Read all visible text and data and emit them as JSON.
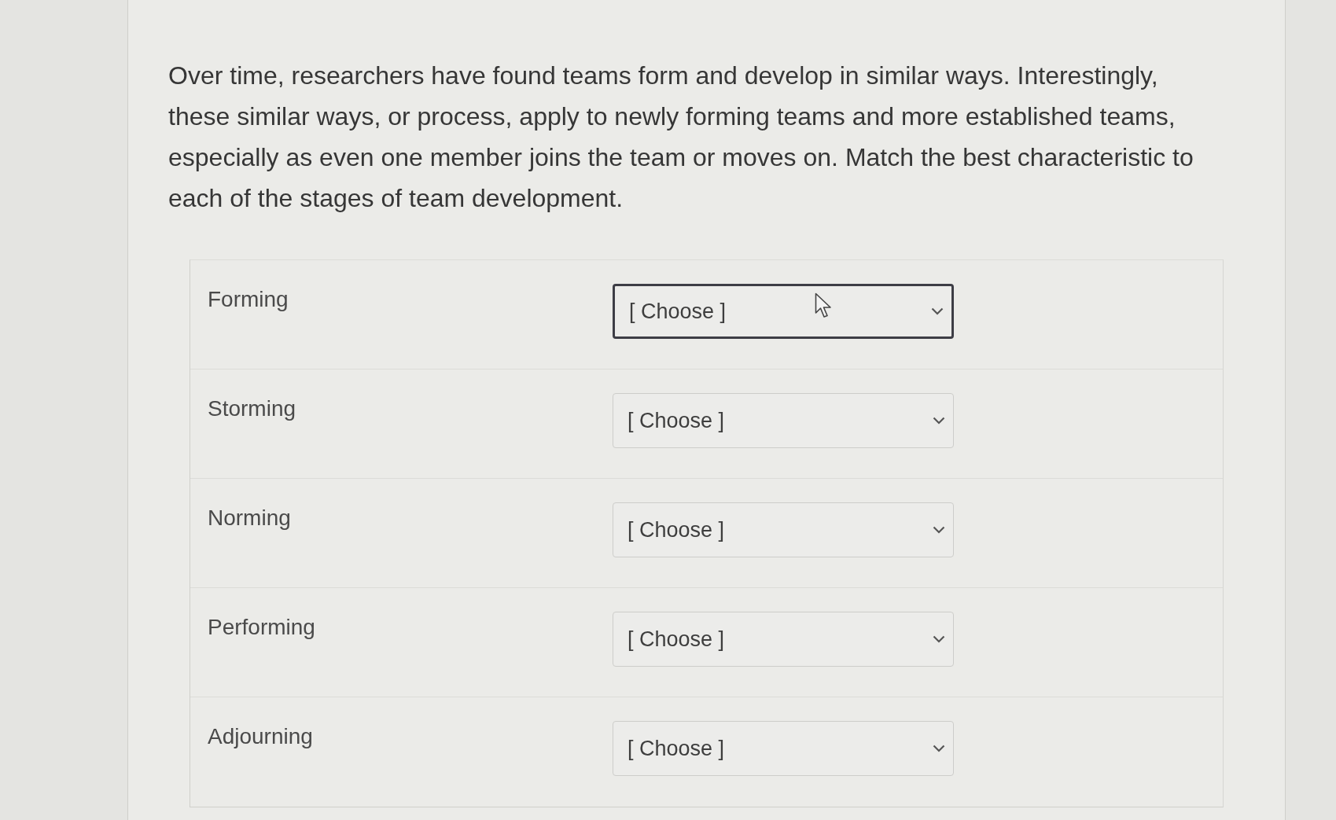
{
  "question": {
    "prompt": "Over time, researchers have found teams form and develop in similar ways. Interestingly, these similar ways, or process, apply to newly forming teams and more established teams, especially as even one member joins the team or moves on.  Match the best characteristic to each of the stages of team development.",
    "matches": [
      {
        "stage": "Forming",
        "select": {
          "value": "[ Choose ]",
          "focused": true
        }
      },
      {
        "stage": "Storming",
        "select": {
          "value": "[ Choose ]",
          "focused": false
        }
      },
      {
        "stage": "Norming",
        "select": {
          "value": "[ Choose ]",
          "focused": false
        }
      },
      {
        "stage": "Performing",
        "select": {
          "value": "[ Choose ]",
          "focused": false
        }
      },
      {
        "stage": "Adjourning",
        "select": {
          "value": "[ Choose ]",
          "focused": false
        }
      }
    ]
  }
}
